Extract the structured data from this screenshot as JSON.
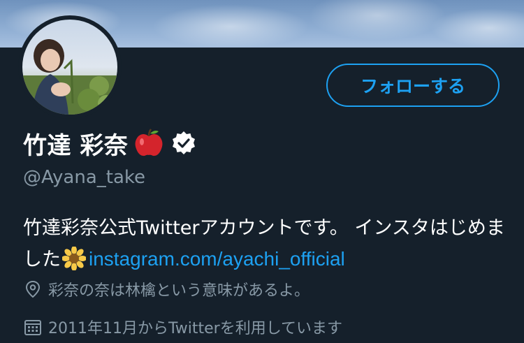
{
  "profile": {
    "display_name": "竹達 彩奈",
    "name_emoji": "apple",
    "verified": true,
    "handle": "@Ayana_take",
    "follow_label": "フォローする",
    "bio_text": "竹達彩奈公式Twitterアカウントです。 インスタはじめました",
    "bio_emoji": "sunflower",
    "bio_link": "instagram.com/ayachi_official",
    "location": "彩奈の奈は林檎という意味があるよ。",
    "joined": "2011年11月からTwitterを利用しています"
  },
  "icons": {
    "location": "location-pin-icon",
    "joined": "calendar-icon",
    "verified": "verified-badge-icon"
  },
  "colors": {
    "background": "#15202b",
    "accent": "#1da1f2",
    "secondary_text": "#8899a6"
  }
}
